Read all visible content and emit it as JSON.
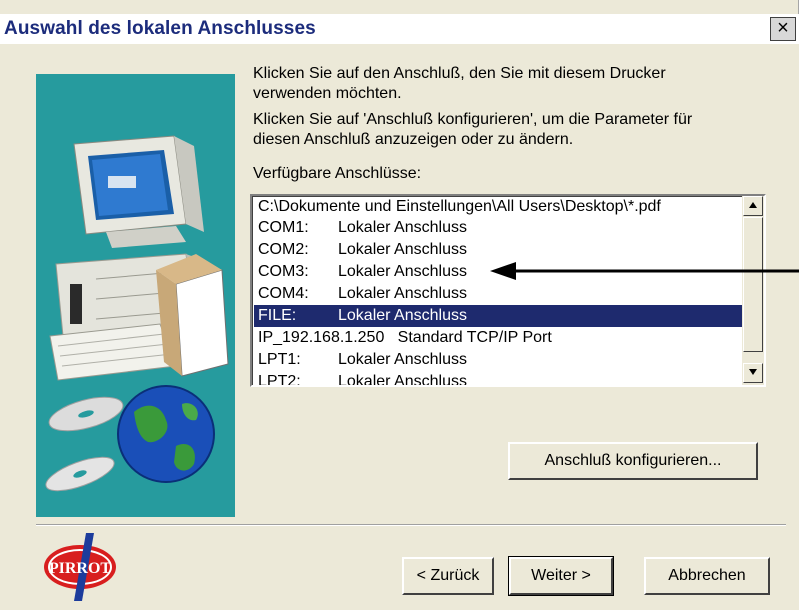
{
  "dialog": {
    "title": "Auswahl des lokalen Anschlusses",
    "close_label": "×"
  },
  "instructions": {
    "line1": "Klicken Sie auf den Anschluß, den Sie mit diesem Drucker",
    "line2": "verwenden möchten.",
    "line3": "Klicken Sie auf 'Anschluß konfigurieren', um die Parameter für",
    "line4": "diesen Anschluß anzuzeigen oder zu ändern.",
    "list_label": "Verfügbare Anschlüsse:"
  },
  "ports": [
    {
      "full": "C:\\Dokumente und Einstellungen\\All Users\\Desktop\\*.pdf"
    },
    {
      "port": "COM1:",
      "desc": "Lokaler Anschluss"
    },
    {
      "port": "COM2:",
      "desc": "Lokaler Anschluss"
    },
    {
      "port": "COM3:",
      "desc": "Lokaler Anschluss"
    },
    {
      "port": "COM4:",
      "desc": "Lokaler Anschluss"
    },
    {
      "port": "FILE:",
      "desc": "Lokaler Anschluss",
      "selected": true
    },
    {
      "full": "IP_192.168.1.250   Standard TCP/IP Port"
    },
    {
      "port": "LPT1:",
      "desc": "Lokaler Anschluss"
    },
    {
      "port": "LPT2:",
      "desc": "Lokaler Anschluss"
    }
  ],
  "buttons": {
    "configure": "Anschluß konfigurieren...",
    "back": "< Zurück",
    "next": "Weiter >",
    "cancel": "Abbrechen"
  },
  "logo": {
    "text": "PIRROT"
  },
  "colors": {
    "selection": "#1e2a6e",
    "title": "#1c2c7c",
    "illustration_bg": "#269b9e",
    "dialog_bg": "#ece9d8"
  },
  "icons": [
    "close-icon",
    "scroll-up-icon",
    "scroll-down-icon",
    "arrow-pointer-icon",
    "computer-icon",
    "globe-icon",
    "cd-icon",
    "pirrot-logo"
  ]
}
